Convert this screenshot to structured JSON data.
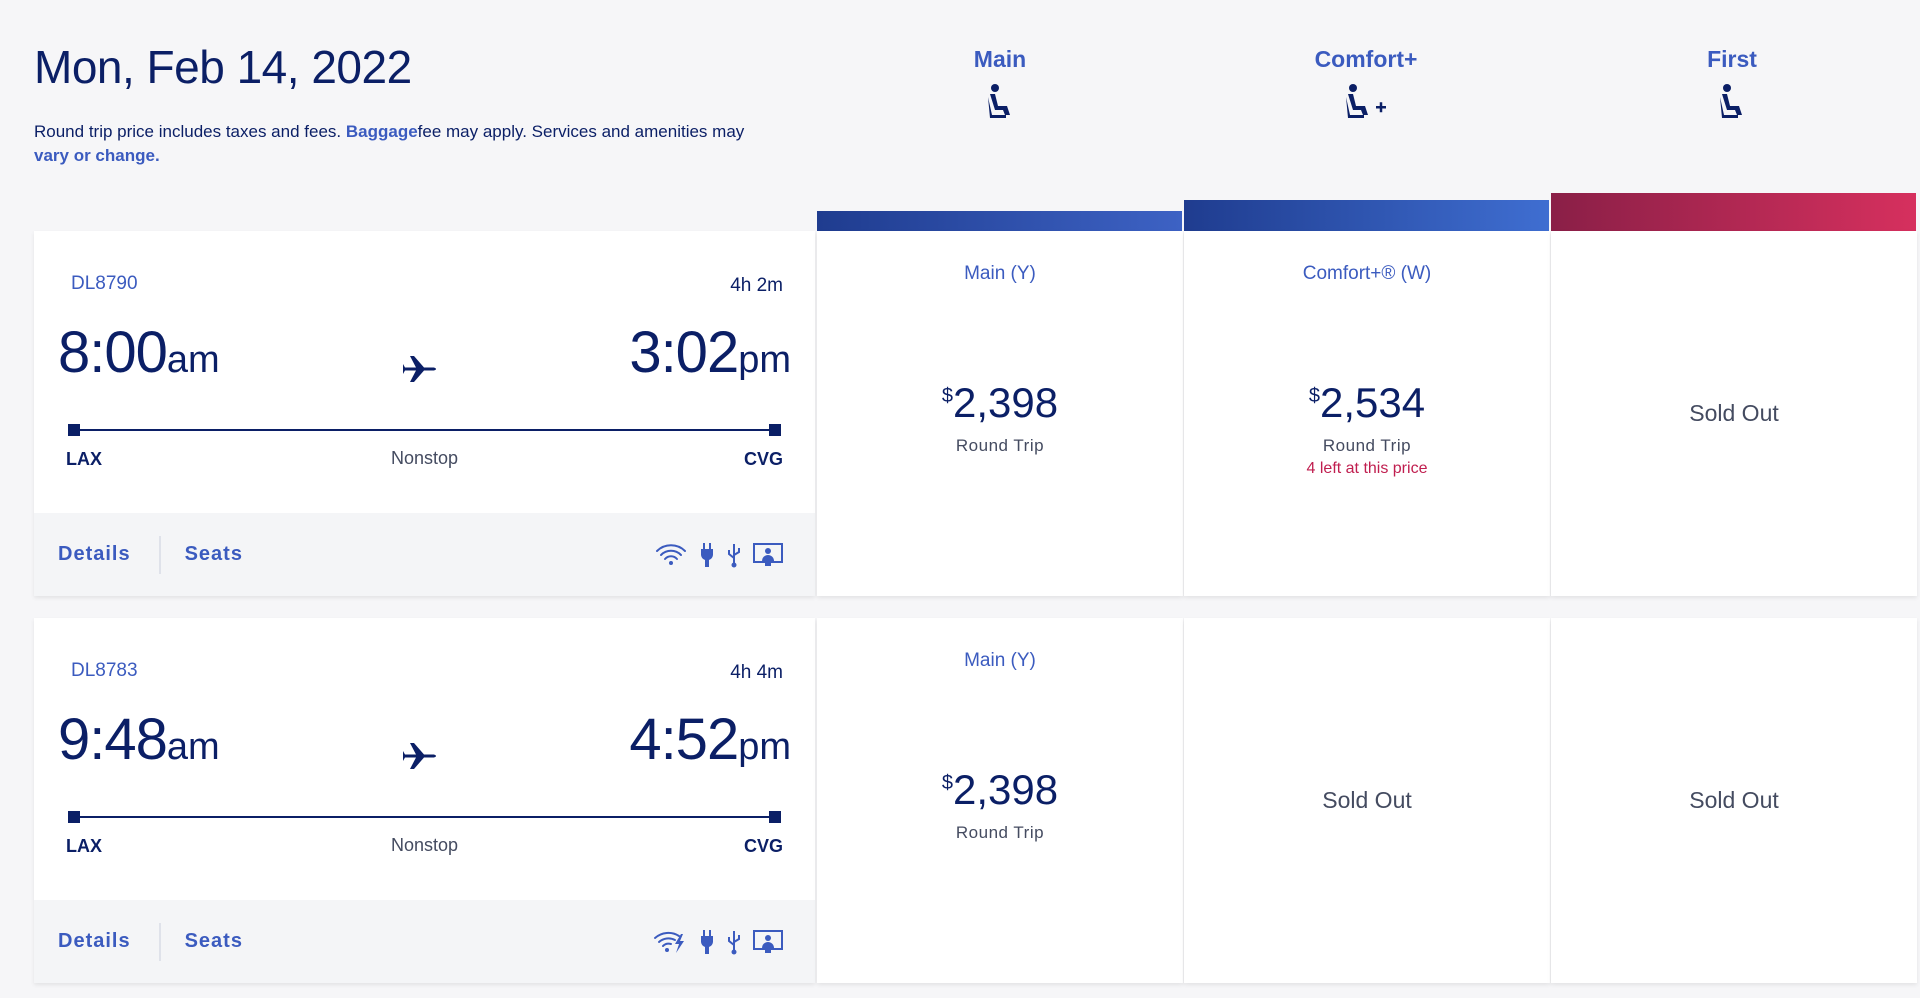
{
  "header": {
    "date": "Mon, Feb 14, 2022",
    "note_prefix": "Round trip price includes taxes and fees.",
    "baggage_link": "Baggage",
    "note_mid": "fee may apply. Services and amenities may",
    "vary_link": "vary or change."
  },
  "cabins": [
    {
      "name": "Main",
      "icon": "seat-icon"
    },
    {
      "name": "Comfort+",
      "icon": "seat-plus-icon"
    },
    {
      "name": "First",
      "icon": "seat-icon"
    }
  ],
  "colors": {
    "main_bar": "#2d4fa8",
    "comfort_bar": "#2f56b6",
    "first_bar": "#b32554",
    "link": "#3b5bbf",
    "text": "#0b1f66",
    "warn": "#c01e4f"
  },
  "flights": [
    {
      "number": "DL8790",
      "duration": "4h 2m",
      "dep_time": "8:00",
      "dep_ampm": "am",
      "arr_time": "3:02",
      "arr_ampm": "pm",
      "origin": "LAX",
      "destination": "CVG",
      "stops": "Nonstop",
      "details_label": "Details",
      "seats_label": "Seats",
      "amenities": [
        "wifi-icon",
        "power-icon",
        "usb-icon",
        "entertainment-icon"
      ],
      "fares": {
        "main": {
          "class": "Main (Y)",
          "currency": "$",
          "price": "2,398",
          "sub": "Round Trip"
        },
        "comfort": {
          "class": "Comfort+® (W)",
          "currency": "$",
          "price": "2,534",
          "sub": "Round Trip",
          "warn": "4 left at this price"
        },
        "first": {
          "sold": "Sold Out"
        }
      }
    },
    {
      "number": "DL8783",
      "duration": "4h 4m",
      "dep_time": "9:48",
      "dep_ampm": "am",
      "arr_time": "4:52",
      "arr_ampm": "pm",
      "origin": "LAX",
      "destination": "CVG",
      "stops": "Nonstop",
      "details_label": "Details",
      "seats_label": "Seats",
      "amenities": [
        "fast-wifi-icon",
        "power-icon",
        "usb-icon",
        "entertainment-icon"
      ],
      "fares": {
        "main": {
          "class": "Main (Y)",
          "currency": "$",
          "price": "2,398",
          "sub": "Round Trip"
        },
        "comfort": {
          "sold": "Sold Out"
        },
        "first": {
          "sold": "Sold Out"
        }
      }
    }
  ]
}
